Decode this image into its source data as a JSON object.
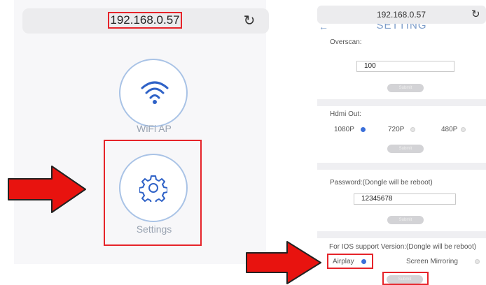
{
  "left": {
    "url": "192.168.0.57",
    "refresh_icon": "↻",
    "wifi_label": "WiFi AP",
    "settings_label": "Settings"
  },
  "right": {
    "url": "192.168.0.57",
    "refresh_icon": "↻",
    "page_title": "SETTING",
    "back_icon": "←",
    "overscan": {
      "label": "Overscan:",
      "value": "100",
      "submit": "Submit"
    },
    "hdmi": {
      "label": "Hdmi Out:",
      "options": [
        "1080P",
        "720P",
        "480P"
      ],
      "selected": "1080P",
      "submit": "Submit"
    },
    "password": {
      "label": "Password:(Dongle will be reboot)",
      "value": "12345678",
      "submit": "Submit"
    },
    "ios": {
      "label": "For IOS support Version:(Dongle will be reboot)",
      "options": [
        "Airplay",
        "Screen Mirroring"
      ],
      "selected": "Airplay",
      "submit": "Submit"
    }
  },
  "colors": {
    "highlight": "#e6242a",
    "accent": "#3b6fd9",
    "arrow": "#e8130f"
  }
}
